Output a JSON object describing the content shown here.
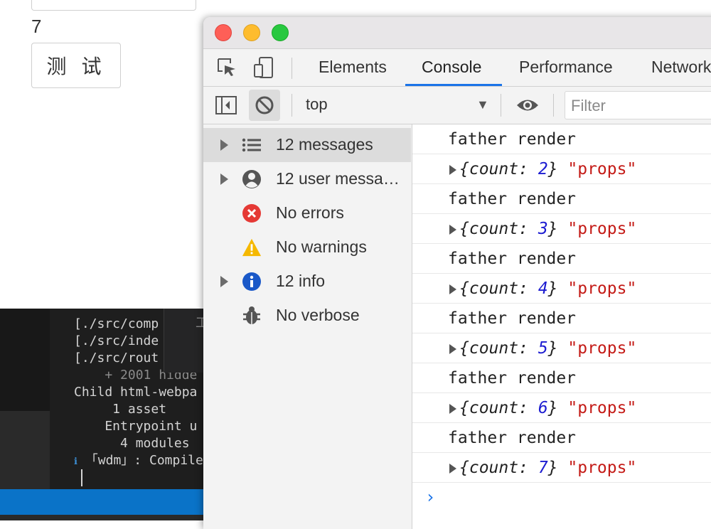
{
  "page": {
    "count": "7",
    "button_label": "测 试"
  },
  "terminal": {
    "lines": [
      "[./src/comp",
      "[./src/inde",
      "[./src/rout",
      "    + 2001 hidde",
      "Child html-webpa",
      "     1 asset",
      "    Entrypoint u",
      "      4 modules",
      "「wdm」: Compile"
    ],
    "hover_glyph": "工"
  },
  "devtools": {
    "tabs": [
      "Elements",
      "Console",
      "Performance",
      "Network"
    ],
    "active_tab": "Console",
    "context": "top",
    "filter_placeholder": "Filter",
    "sidebar": [
      {
        "label": "12 messages",
        "icon": "list-icon",
        "expandable": true,
        "selected": true
      },
      {
        "label": "12 user messa…",
        "icon": "user-icon",
        "expandable": true,
        "selected": false
      },
      {
        "label": "No errors",
        "icon": "error-icon",
        "expandable": false,
        "selected": false
      },
      {
        "label": "No warnings",
        "icon": "warning-icon",
        "expandable": false,
        "selected": false
      },
      {
        "label": "12 info",
        "icon": "info-icon",
        "expandable": true,
        "selected": false
      },
      {
        "label": "No verbose",
        "icon": "bug-icon",
        "expandable": false,
        "selected": false
      }
    ],
    "console": {
      "render_text": "father render",
      "prop_key": "count",
      "prop_string": "\"props\"",
      "counts": [
        "2",
        "3",
        "4",
        "5",
        "6",
        "7"
      ]
    },
    "colors": {
      "accent": "#1a73e8",
      "string": "#c41a16",
      "number": "#1c1cd1",
      "error": "#e53935",
      "warning": "#f5b800",
      "info": "#1a58c8"
    }
  }
}
